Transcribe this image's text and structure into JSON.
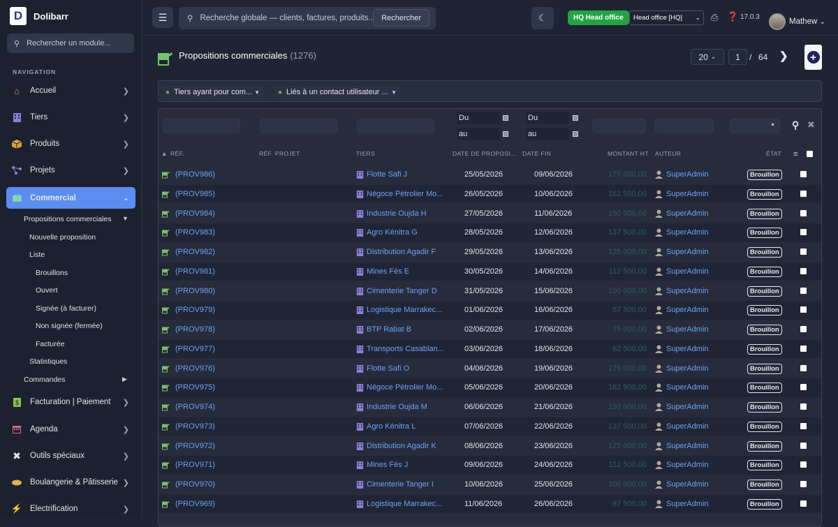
{
  "app": {
    "brand": "Dolibarr"
  },
  "sidebar": {
    "search_placeholder": "Rechercher un module...",
    "nav_heading": "NAVIGATION",
    "items": [
      {
        "label": "Accueil",
        "icon": "home-icon"
      },
      {
        "label": "Tiers",
        "icon": "building-icon"
      },
      {
        "label": "Produits",
        "icon": "box-icon"
      },
      {
        "label": "Projets",
        "icon": "project-icon"
      },
      {
        "label": "Commercial",
        "icon": "briefcase-icon"
      },
      {
        "label": "Facturation | Paiement",
        "icon": "invoice-icon"
      },
      {
        "label": "Agenda",
        "icon": "calendar-icon"
      },
      {
        "label": "Outils spéciaux",
        "icon": "tools-icon"
      },
      {
        "label": "Boulangerie & Pâtisserie",
        "icon": "bread-icon"
      },
      {
        "label": "Electrification",
        "icon": "bolt-icon"
      }
    ],
    "sub": {
      "propales": "Propositions commerciales",
      "nouvelle": "Nouvelle proposition",
      "liste": "Liste",
      "brouillons": "Brouillons",
      "ouvert": "Ouvert",
      "signee": "Signée (à facturer)",
      "nonsignee": "Non signée (fermée)",
      "facturee": "Facturée",
      "stats": "Statistiques",
      "commandes": "Commandes"
    }
  },
  "topbar": {
    "search_placeholder": "Recherche globale — clients, factures, produits...",
    "search_button": "Rechercher",
    "hq_badge": "HQ  Head office",
    "entity_select": "Head office [HQ]",
    "version": "17.0.3",
    "user": "Mathew"
  },
  "page": {
    "title": "Propositions commerciales",
    "count": "(1276)",
    "limit": "20",
    "page": "1",
    "slash": "/",
    "total_pages": "64"
  },
  "filters": {
    "third_party": "Tiers ayant pour com...",
    "contact": "Liés à un contact utilisateur ...",
    "du": "Du",
    "au": "au"
  },
  "columns": {
    "ref": "RÉF.",
    "ref_projet": "RÉF. PROJET",
    "tiers": "TIERS",
    "date_prop": "DATE DE PROPOSI...",
    "date_fin": "DATE FIN",
    "montant": "MONTANT HT",
    "auteur": "AUTEUR",
    "etat": "ÉTAT"
  },
  "rows": [
    {
      "ref": "(PROV986)",
      "tiers": "Flotte Safi J",
      "date": "25/05/2026",
      "fin": "09/06/2026",
      "amount": "175 000,00",
      "author": "SuperAdmin",
      "status": "Brouillon"
    },
    {
      "ref": "(PROV985)",
      "tiers": "Négoce Pétrolier Mo...",
      "date": "26/05/2026",
      "fin": "10/06/2026",
      "amount": "162 500,00",
      "author": "SuperAdmin",
      "status": "Brouillon"
    },
    {
      "ref": "(PROV984)",
      "tiers": "Industrie Oujda H",
      "date": "27/05/2026",
      "fin": "11/06/2026",
      "amount": "150 000,00",
      "author": "SuperAdmin",
      "status": "Brouillon"
    },
    {
      "ref": "(PROV983)",
      "tiers": "Agro Kénitra G",
      "date": "28/05/2026",
      "fin": "12/06/2026",
      "amount": "137 500,00",
      "author": "SuperAdmin",
      "status": "Brouillon"
    },
    {
      "ref": "(PROV982)",
      "tiers": "Distribution Agadir F",
      "date": "29/05/2026",
      "fin": "13/06/2026",
      "amount": "125 000,00",
      "author": "SuperAdmin",
      "status": "Brouillon"
    },
    {
      "ref": "(PROV981)",
      "tiers": "Mines Fès E",
      "date": "30/05/2026",
      "fin": "14/06/2026",
      "amount": "112 500,00",
      "author": "SuperAdmin",
      "status": "Brouillon"
    },
    {
      "ref": "(PROV980)",
      "tiers": "Cimenterie Tanger D",
      "date": "31/05/2026",
      "fin": "15/06/2026",
      "amount": "100 000,00",
      "author": "SuperAdmin",
      "status": "Brouillon"
    },
    {
      "ref": "(PROV979)",
      "tiers": "Logistique Marrakec...",
      "date": "01/06/2026",
      "fin": "16/06/2026",
      "amount": "87 500,00",
      "author": "SuperAdmin",
      "status": "Brouillon"
    },
    {
      "ref": "(PROV978)",
      "tiers": "BTP Rabat B",
      "date": "02/06/2026",
      "fin": "17/06/2026",
      "amount": "75 000,00",
      "author": "SuperAdmin",
      "status": "Brouillon"
    },
    {
      "ref": "(PROV977)",
      "tiers": "Transports Casablan...",
      "date": "03/06/2026",
      "fin": "18/06/2026",
      "amount": "62 500,00",
      "author": "SuperAdmin",
      "status": "Brouillon"
    },
    {
      "ref": "(PROV976)",
      "tiers": "Flotte Safi O",
      "date": "04/06/2026",
      "fin": "19/06/2026",
      "amount": "175 000,00",
      "author": "SuperAdmin",
      "status": "Brouillon"
    },
    {
      "ref": "(PROV975)",
      "tiers": "Négoce Pétrolier Mo...",
      "date": "05/06/2026",
      "fin": "20/06/2026",
      "amount": "162 500,00",
      "author": "SuperAdmin",
      "status": "Brouillon"
    },
    {
      "ref": "(PROV974)",
      "tiers": "Industrie Oujda M",
      "date": "06/06/2026",
      "fin": "21/06/2026",
      "amount": "150 000,00",
      "author": "SuperAdmin",
      "status": "Brouillon"
    },
    {
      "ref": "(PROV973)",
      "tiers": "Agro Kénitra L",
      "date": "07/06/2026",
      "fin": "22/06/2026",
      "amount": "137 500,00",
      "author": "SuperAdmin",
      "status": "Brouillon"
    },
    {
      "ref": "(PROV972)",
      "tiers": "Distribution Agadir K",
      "date": "08/06/2026",
      "fin": "23/06/2026",
      "amount": "125 000,00",
      "author": "SuperAdmin",
      "status": "Brouillon"
    },
    {
      "ref": "(PROV971)",
      "tiers": "Mines Fès J",
      "date": "09/06/2026",
      "fin": "24/06/2026",
      "amount": "112 500,00",
      "author": "SuperAdmin",
      "status": "Brouillon"
    },
    {
      "ref": "(PROV970)",
      "tiers": "Cimenterie Tanger I",
      "date": "10/06/2026",
      "fin": "25/06/2026",
      "amount": "100 000,00",
      "author": "SuperAdmin",
      "status": "Brouillon"
    },
    {
      "ref": "(PROV969)",
      "tiers": "Logistique Marrakec...",
      "date": "11/06/2026",
      "fin": "26/06/2026",
      "amount": "87 500,00",
      "author": "SuperAdmin",
      "status": "Brouillon"
    }
  ],
  "colors": {
    "accent": "#5b8def",
    "link": "#6fa0f5",
    "hq_green": "#25a244",
    "amount": "#2c5d5a"
  }
}
